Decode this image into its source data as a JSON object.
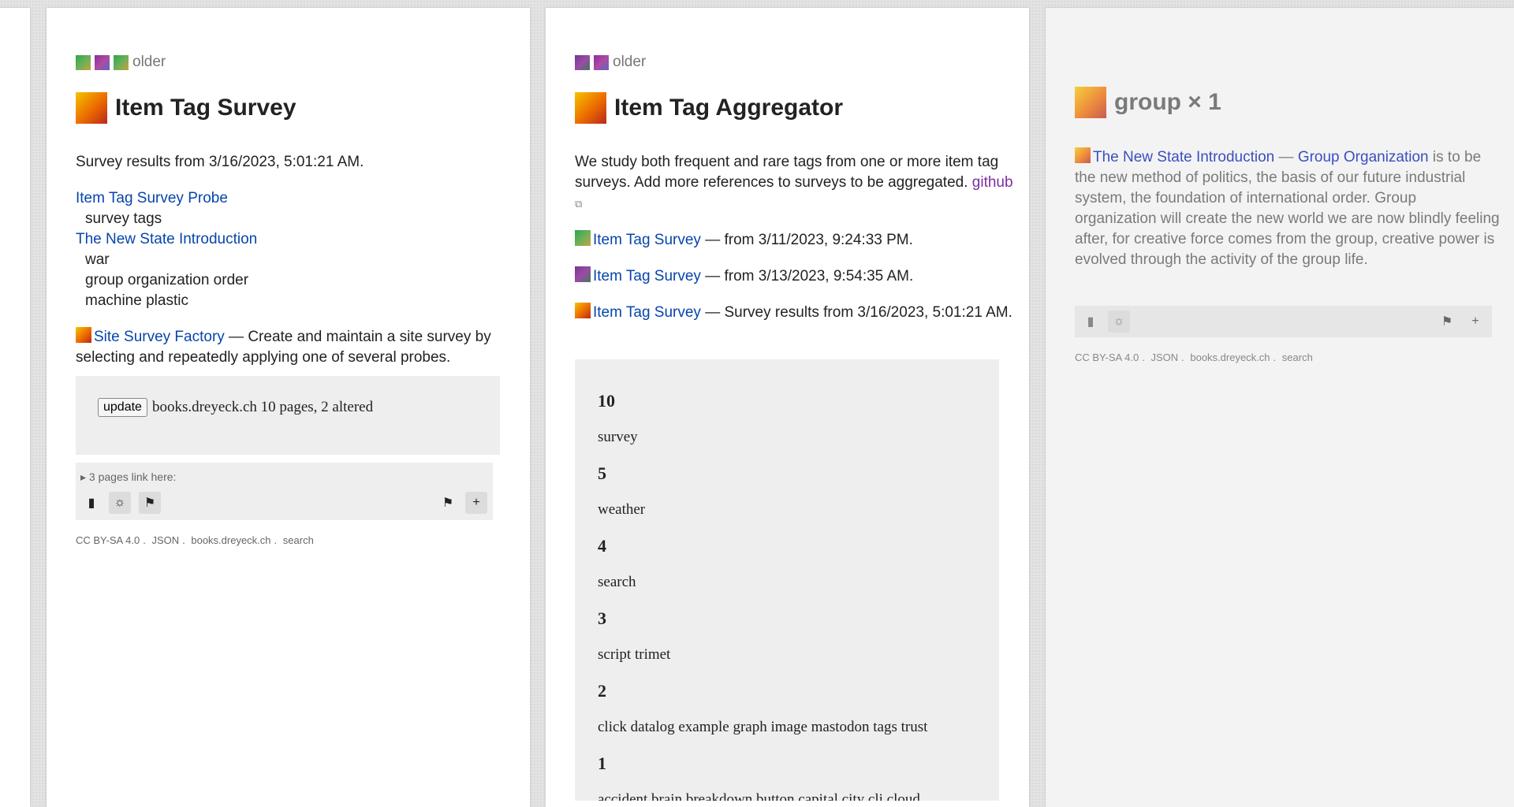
{
  "page1": {
    "twins_label": "older",
    "title": "Item Tag Survey",
    "summary": "Survey results from 3/16/2023, 5:01:21 AM.",
    "refs": [
      {
        "link": "Item Tag Survey Probe",
        "items": [
          "survey tags"
        ]
      },
      {
        "link": "The New State Introduction",
        "items": [
          "war",
          "group organization order",
          "machine plastic"
        ]
      }
    ],
    "factory": {
      "link": "Site Survey Factory",
      "text": " — Create and maintain a site survey by selecting and repeatedly applying one of several probes."
    },
    "survey": {
      "button": "update",
      "text": "books.dreyeck.ch 10 pages, 2 altered"
    },
    "backlinks": "▸ 3 pages link here:",
    "license": {
      "cc": "CC BY-SA 4.0",
      "json": "JSON",
      "site": "books.dreyeck.ch",
      "search": "search"
    }
  },
  "page2": {
    "twins_label": "older",
    "title": "Item Tag Aggregator",
    "intro": "We study both frequent and rare tags from one or more item tag surveys. Add more references to surveys to be aggregated.",
    "github": "github",
    "refs": [
      {
        "link": "Item Tag Survey",
        "text": " — from 3/11/2023, 9:24:33 PM."
      },
      {
        "link": "Item Tag Survey",
        "text": " — from 3/13/2023, 9:54:35 AM."
      },
      {
        "link": "Item Tag Survey",
        "text": " — Survey results from 3/16/2023, 5:01:21 AM."
      }
    ],
    "aggregate": [
      {
        "count": "10",
        "tags": "survey"
      },
      {
        "count": "5",
        "tags": "weather"
      },
      {
        "count": "4",
        "tags": "search"
      },
      {
        "count": "3",
        "tags": "script trimet"
      },
      {
        "count": "2",
        "tags": "click datalog example graph image mastodon tags trust"
      },
      {
        "count": "1",
        "tags": "accident brain breakdown button capital city cli cloud"
      }
    ]
  },
  "page3": {
    "title": "group × 1",
    "link1": "The New State Introduction",
    "dash": " — ",
    "link2": "Group Organization",
    "text": " is to be the new method of politics, the basis of our future industrial system, the foundation of international order. Group organization will create the new world we are now blindly feeling after, for creative force comes from the group, creative power is evolved through the activity of the group life.",
    "license": {
      "cc": "CC BY-SA 4.0",
      "json": "JSON",
      "site": "books.dreyeck.ch",
      "search": "search"
    }
  },
  "icons": {
    "paste": "▮",
    "gear": "☼",
    "flag": "⚑",
    "plus": "+",
    "external": "⧉",
    "dot": "."
  }
}
